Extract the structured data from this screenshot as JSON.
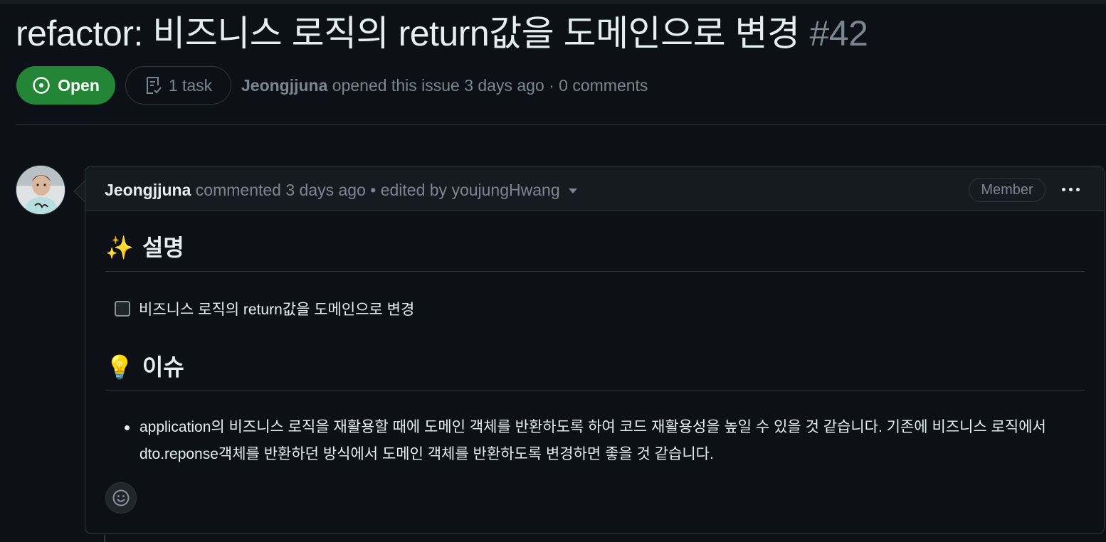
{
  "issue": {
    "title": "refactor: 비즈니스 로직의 return값을 도메인으로 변경",
    "number": "#42",
    "status": "Open",
    "tasks": "1 task",
    "author": "Jeongjjuna",
    "meta_text": " opened this issue 3 days ago · 0 comments"
  },
  "comment": {
    "author": "Jeongjjuna",
    "action_text": " commented 3 days ago • edited by youjungHwang",
    "role_badge": "Member",
    "sections": [
      {
        "emoji": "✨",
        "heading": "설명"
      },
      {
        "emoji": "💡",
        "heading": "이슈"
      }
    ],
    "task_item": {
      "label": "비즈니스 로직의 return값을 도메인으로 변경",
      "checked": false
    },
    "bullet_text": "application의 비즈니스 로직을 재활용할 때에 도메인 객체를 반환하도록 하여 코드 재활용성을 높일 수 있을 것 같습니다. 기존에 비즈니스 로직에서 dto.reponse객체를 반환하던 방식에서 도메인 객체를 반환하도록 변경하면 좋을 것 같습니다."
  },
  "icons": {
    "status": "issue-opened-icon",
    "tasks": "checklist-icon",
    "menu": "kebab-horizontal-icon",
    "reaction": "smiley-icon",
    "dropdown": "triangle-down-icon"
  },
  "colors": {
    "background": "#0d1117",
    "header": "#161b22",
    "border": "#30363d",
    "text": "#e6edf3",
    "muted": "#7d8590",
    "open_green": "#238636"
  }
}
